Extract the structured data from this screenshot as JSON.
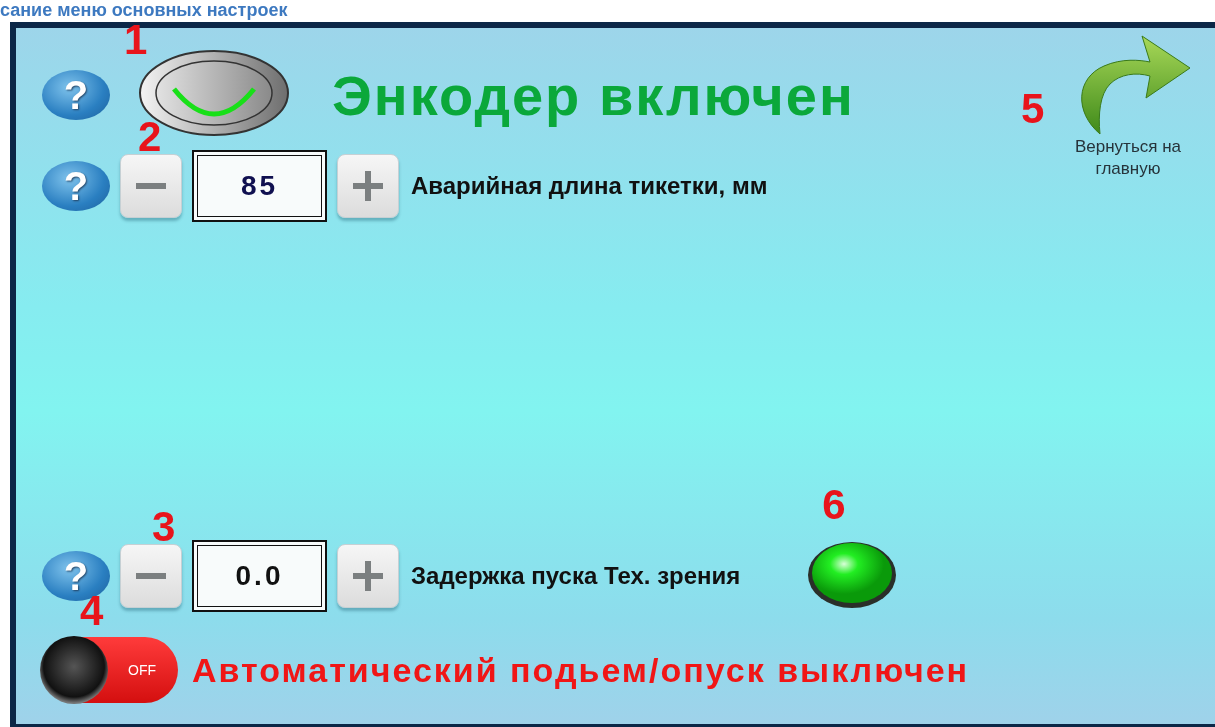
{
  "header": {
    "title": "сание меню основных настроек"
  },
  "encoder": {
    "marker": "1",
    "help_icon": "?",
    "on": true,
    "status": "Энкодер включен"
  },
  "return_button": {
    "marker": "5",
    "label": "Вернуться на главную"
  },
  "settings": [
    {
      "marker": "2",
      "help_icon": "?",
      "value": "85",
      "label": "Аварийная длина тикетки, мм"
    },
    {
      "marker": "3",
      "help_icon": "?",
      "value": "0.0",
      "label": "Задержка пуска Тех. зрения"
    }
  ],
  "indicator": {
    "marker": "6",
    "on": true
  },
  "auto_lift": {
    "marker": "4",
    "on": false,
    "switch_text": "OFF",
    "status": "Автоматический подьем/опуск выключен"
  }
}
